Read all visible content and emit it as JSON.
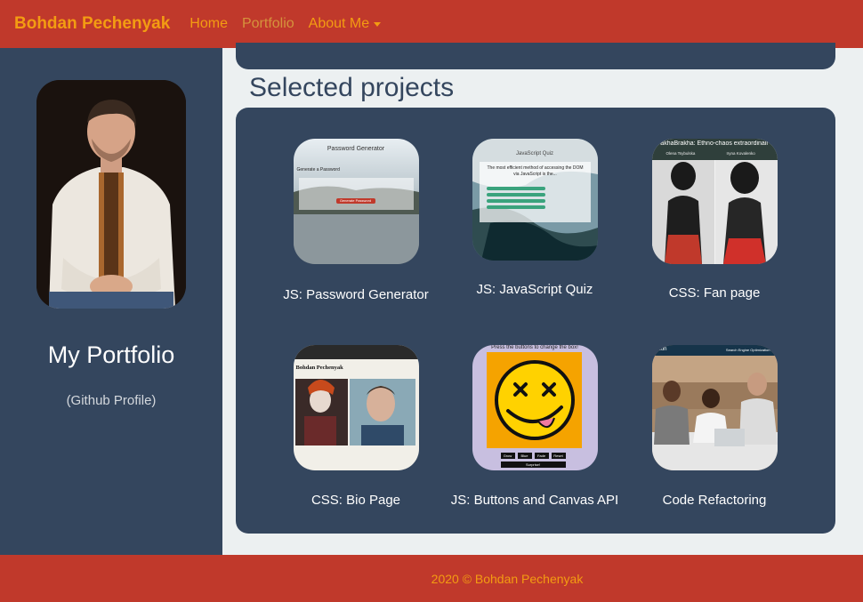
{
  "nav": {
    "brand": "Bohdan Pechenyak",
    "home": "Home",
    "portfolio": "Portfolio",
    "about": "About Me"
  },
  "sidebar": {
    "title": "My Portfolio",
    "github_link": "(Github Profile)"
  },
  "main": {
    "section_title": "Selected projects",
    "projects": [
      {
        "label": "JS: Password Generator",
        "thumb_title": "Password Generator",
        "thumb_sub": "Generate a Password",
        "thumb_button": "Generate Password"
      },
      {
        "label": "JS: JavaScript Quiz",
        "thumb_title": "JavaScript Quiz",
        "thumb_sub": "The most efficient method of accessing the DOM via JavaScript is the..."
      },
      {
        "label": "CSS: Fan page",
        "thumb_title": "akhaBrakha: Ethno-chaos extraordinair",
        "thumb_names": [
          "Olena Tsybulska",
          "Iryna Kovalenko"
        ]
      },
      {
        "label": "CSS: Bio Page",
        "thumb_title": "Bohdan Pechenyak"
      },
      {
        "label": "JS: Buttons and Canvas API",
        "thumb_title": "Press the buttons to change the box!",
        "thumb_buttons": [
          "Grow",
          "Blue",
          "Fade",
          "Reset"
        ],
        "thumb_surprise": "Surprise!"
      },
      {
        "label": "Code Refactoring",
        "thumb_title": "rizon",
        "thumb_sub": "Search Engine Optimization"
      }
    ]
  },
  "footer": {
    "text": "2020 © Bohdan Pechenyak"
  }
}
